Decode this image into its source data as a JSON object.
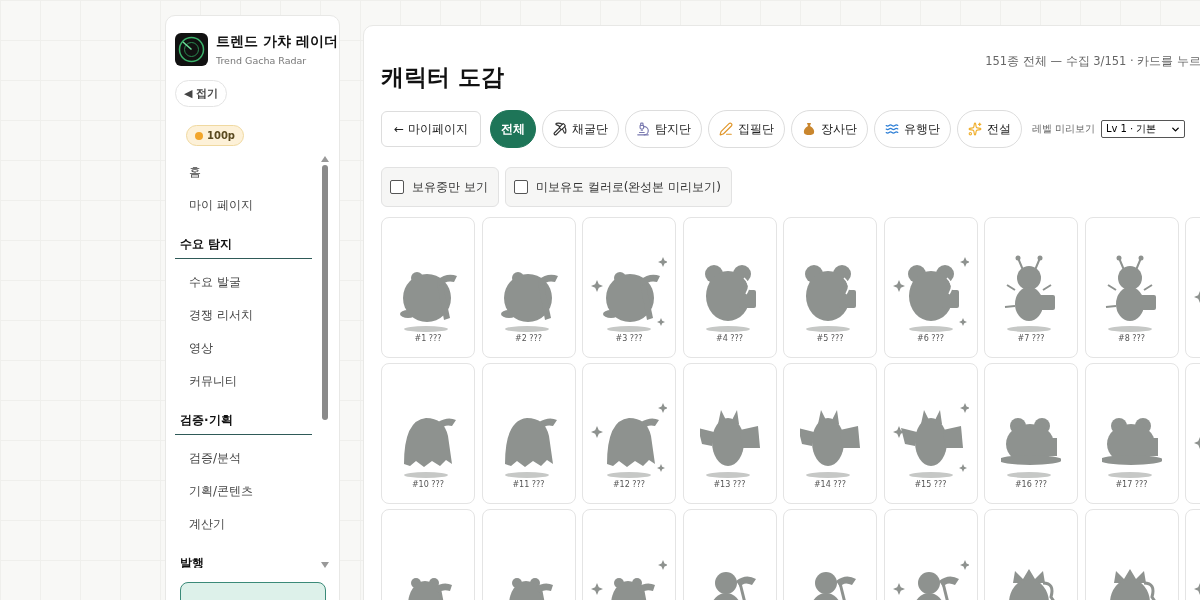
{
  "sidebar": {
    "app_title": "트렌드 가챠 레이더",
    "app_subtitle": "Trend Gacha Radar",
    "collapse_button": "◀ 접기",
    "points": "100p",
    "nav": [
      {
        "kind": "item",
        "label": "홈"
      },
      {
        "kind": "item",
        "label": "마이 페이지"
      },
      {
        "kind": "section",
        "label": "수요 탐지"
      },
      {
        "kind": "item",
        "label": "수요 발굴"
      },
      {
        "kind": "item",
        "label": "경쟁 리서치"
      },
      {
        "kind": "item",
        "label": "영상"
      },
      {
        "kind": "item",
        "label": "커뮤니티"
      },
      {
        "kind": "section",
        "label": "검증·기획"
      },
      {
        "kind": "item",
        "label": "검증/분석"
      },
      {
        "kind": "item",
        "label": "기획/콘텐츠"
      },
      {
        "kind": "item",
        "label": "계산기"
      },
      {
        "kind": "section",
        "label": "발행"
      }
    ]
  },
  "page": {
    "title": "캐릭터 도감",
    "summary": "151종 전체 — 수집 3/151 · 카드를 누르",
    "back_button": "← 마이페이지",
    "filters": [
      {
        "label": "전체",
        "selected": true
      },
      {
        "label": "채굴단",
        "selected": false
      },
      {
        "label": "탐지단",
        "selected": false
      },
      {
        "label": "집필단",
        "selected": false
      },
      {
        "label": "장사단",
        "selected": false
      },
      {
        "label": "유행단",
        "selected": false
      },
      {
        "label": "전설",
        "selected": false
      }
    ],
    "level_label": "레벨 미리보기",
    "level_value": "Lv 1 · 기본",
    "toggles": [
      {
        "label": "보유중만 보기",
        "checked": false
      },
      {
        "label": "미보유도 컬러로(완성본 미리보기)",
        "checked": false
      }
    ],
    "cards": [
      {
        "kind": "flag",
        "sparkle": false,
        "label": "#1 ???"
      },
      {
        "kind": "flag",
        "sparkle": false,
        "label": "#2 ???"
      },
      {
        "kind": "flag",
        "sparkle": true,
        "label": "#3 ???"
      },
      {
        "kind": "speaker",
        "sparkle": false,
        "label": "#4 ???"
      },
      {
        "kind": "speaker",
        "sparkle": false,
        "label": "#5 ???"
      },
      {
        "kind": "speaker",
        "sparkle": true,
        "label": "#6 ???"
      },
      {
        "kind": "bug",
        "sparkle": false,
        "label": "#7 ???"
      },
      {
        "kind": "bug",
        "sparkle": false,
        "label": "#8 ???"
      },
      {
        "kind": "bug",
        "sparkle": true
      },
      {
        "kind": "ghost",
        "sparkle": false,
        "label": "#10 ???"
      },
      {
        "kind": "ghost",
        "sparkle": false,
        "label": "#11 ???"
      },
      {
        "kind": "ghost",
        "sparkle": true,
        "label": "#12 ???"
      },
      {
        "kind": "bat",
        "sparkle": false,
        "label": "#13 ???"
      },
      {
        "kind": "bat",
        "sparkle": false,
        "label": "#14 ???"
      },
      {
        "kind": "bat",
        "sparkle": true,
        "label": "#15 ???"
      },
      {
        "kind": "frog",
        "sparkle": false,
        "label": "#16 ???"
      },
      {
        "kind": "frog",
        "sparkle": false,
        "label": "#17 ???"
      },
      {
        "kind": "frog",
        "sparkle": true
      },
      {
        "kind": "hook",
        "sparkle": false
      },
      {
        "kind": "hook",
        "sparkle": false
      },
      {
        "kind": "hook",
        "sparkle": true
      },
      {
        "kind": "gourd",
        "sparkle": false
      },
      {
        "kind": "gourd",
        "sparkle": false
      },
      {
        "kind": "gourd",
        "sparkle": true
      },
      {
        "kind": "crown",
        "sparkle": false
      },
      {
        "kind": "crown",
        "sparkle": false
      },
      {
        "kind": "crown",
        "sparkle": true
      }
    ]
  }
}
